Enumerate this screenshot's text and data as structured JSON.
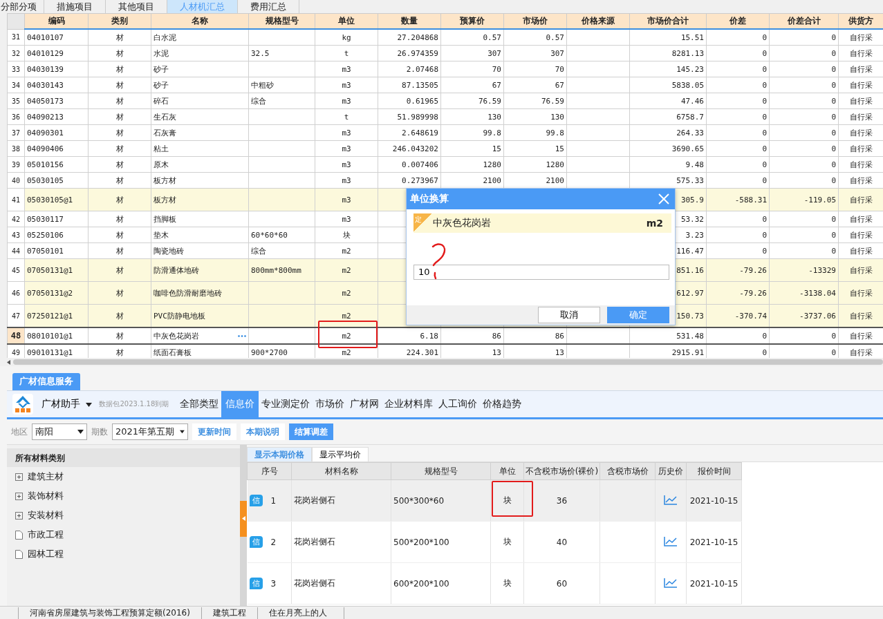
{
  "top_tabs": [
    {
      "label": "分部分项",
      "selected": false
    },
    {
      "label": "措施项目",
      "selected": false
    },
    {
      "label": "其他项目",
      "selected": false
    },
    {
      "label": "人材机汇总",
      "selected": true
    },
    {
      "label": "费用汇总",
      "selected": false
    }
  ],
  "table": {
    "columns": [
      "编码",
      "类别",
      "名称",
      "规格型号",
      "单位",
      "数量",
      "预算价",
      "市场价",
      "价格来源",
      "市场价合计",
      "价差",
      "价差合计",
      "供货方"
    ],
    "rows": [
      {
        "no": "31",
        "code": "04010107",
        "type": "材",
        "name": "白水泥",
        "unit": "kg",
        "qty": "27.204868",
        "budget": "0.57",
        "market": "0.57",
        "total": "15.51",
        "diff": "0",
        "diff_total": "0",
        "supply": "自行采",
        "modified": false,
        "selected": false
      },
      {
        "no": "32",
        "code": "04010129",
        "type": "材",
        "name": "水泥",
        "spec": "32.5",
        "unit": "t",
        "qty": "26.974359",
        "budget": "307",
        "market": "307",
        "total": "8281.13",
        "diff": "0",
        "diff_total": "0",
        "supply": "自行采",
        "modified": false,
        "selected": false
      },
      {
        "no": "33",
        "code": "04030139",
        "type": "材",
        "name": "砂子",
        "unit": "m3",
        "qty": "2.07468",
        "budget": "70",
        "market": "70",
        "total": "145.23",
        "diff": "0",
        "diff_total": "0",
        "supply": "自行采",
        "modified": false,
        "selected": false
      },
      {
        "no": "34",
        "code": "04030143",
        "type": "材",
        "name": "砂子",
        "spec": "中粗砂",
        "unit": "m3",
        "qty": "87.13505",
        "budget": "67",
        "market": "67",
        "total": "5838.05",
        "diff": "0",
        "diff_total": "0",
        "supply": "自行采",
        "modified": false,
        "selected": false
      },
      {
        "no": "35",
        "code": "04050173",
        "type": "材",
        "name": "碎石",
        "spec": "综合",
        "unit": "m3",
        "qty": "0.61965",
        "budget": "76.59",
        "market": "76.59",
        "total": "47.46",
        "diff": "0",
        "diff_total": "0",
        "supply": "自行采",
        "modified": false,
        "selected": false
      },
      {
        "no": "36",
        "code": "04090213",
        "type": "材",
        "name": "生石灰",
        "unit": "t",
        "qty": "51.989998",
        "budget": "130",
        "market": "130",
        "total": "6758.7",
        "diff": "0",
        "diff_total": "0",
        "supply": "自行采",
        "modified": false,
        "selected": false
      },
      {
        "no": "37",
        "code": "04090301",
        "type": "材",
        "name": "石灰膏",
        "unit": "m3",
        "qty": "2.648619",
        "budget": "99.8",
        "market": "99.8",
        "total": "264.33",
        "diff": "0",
        "diff_total": "0",
        "supply": "自行采",
        "modified": false,
        "selected": false
      },
      {
        "no": "38",
        "code": "04090406",
        "type": "材",
        "name": "粘土",
        "unit": "m3",
        "qty": "246.043202",
        "budget": "15",
        "market": "15",
        "total": "3690.65",
        "diff": "0",
        "diff_total": "0",
        "supply": "自行采",
        "modified": false,
        "selected": false
      },
      {
        "no": "39",
        "code": "05010156",
        "type": "材",
        "name": "原木",
        "unit": "m3",
        "qty": "0.007406",
        "budget": "1280",
        "market": "1280",
        "total": "9.48",
        "diff": "0",
        "diff_total": "0",
        "supply": "自行采",
        "modified": false,
        "selected": false
      },
      {
        "no": "40",
        "code": "05030105",
        "type": "材",
        "name": "板方材",
        "unit": "m3",
        "qty": "0.273967",
        "budget": "2100",
        "market": "2100",
        "total": "575.33",
        "diff": "0",
        "diff_total": "0",
        "supply": "自行采",
        "modified": false,
        "selected": false
      },
      {
        "no": "41",
        "code": "05030105@1",
        "type": "材",
        "name": "板方材",
        "unit": "m3",
        "total": "305.9",
        "diff": "-588.31",
        "diff_total": "-119.05",
        "supply": "自行采",
        "modified": true,
        "selected": false
      },
      {
        "no": "42",
        "code": "05030117",
        "type": "材",
        "name": "挡脚板",
        "unit": "m3",
        "total": "53.32",
        "diff": "0",
        "diff_total": "0",
        "supply": "自行采",
        "modified": false,
        "selected": false
      },
      {
        "no": "43",
        "code": "05250106",
        "type": "材",
        "name": "垫木",
        "spec": "60*60*60",
        "unit": "块",
        "total": "3.23",
        "diff": "0",
        "diff_total": "0",
        "supply": "自行采",
        "modified": false,
        "selected": false
      },
      {
        "no": "44",
        "code": "07050101",
        "type": "材",
        "name": "陶瓷地砖",
        "spec": "综合",
        "unit": "m2",
        "total": "116.47",
        "diff": "0",
        "diff_total": "0",
        "supply": "自行采",
        "modified": false,
        "selected": false
      },
      {
        "no": "45",
        "code": "07050131@1",
        "type": "材",
        "name": "防滑通体地砖",
        "spec": "800mm*800mm",
        "unit": "m2",
        "total": "851.16",
        "diff": "-79.26",
        "diff_total": "-13329",
        "supply": "自行采",
        "modified": true,
        "selected": false
      },
      {
        "no": "46",
        "code": "07050131@2",
        "type": "材",
        "name": "咖啡色防滑耐磨地砖",
        "unit": "m2",
        "total": "612.97",
        "diff": "-79.26",
        "diff_total": "-3138.04",
        "supply": "自行采",
        "modified": true,
        "selected": false
      },
      {
        "no": "47",
        "code": "07250121@1",
        "type": "材",
        "name": "PVC防静电地板",
        "unit": "m2",
        "total": "150.73",
        "diff": "-370.74",
        "diff_total": "-3737.06",
        "supply": "自行采",
        "modified": true,
        "selected": false
      },
      {
        "no": "48",
        "code": "08010101@1",
        "type": "材",
        "name": "中灰色花岗岩",
        "unit": "m2",
        "qty": "6.18",
        "budget": "86",
        "market": "86",
        "total": "531.48",
        "diff": "0",
        "diff_total": "0",
        "supply": "自行采",
        "modified": false,
        "selected": true
      },
      {
        "no": "49",
        "code": "09010131@1",
        "type": "材",
        "name": "纸面石膏板",
        "spec": "900*2700",
        "unit": "m2",
        "qty": "224.301",
        "budget": "13",
        "market": "13",
        "total": "2915.91",
        "diff": "0",
        "diff_total": "0",
        "supply": "自行采",
        "modified": false,
        "selected": false
      }
    ]
  },
  "dialog": {
    "title": "单位换算",
    "badge": "定",
    "material": "中灰色花岗岩",
    "unit": "m2",
    "value": "10",
    "buttons": [
      {
        "label": "取消",
        "primary": false
      },
      {
        "label": "确定",
        "primary": true
      }
    ]
  },
  "panel": {
    "tab": "广材信息服务",
    "brand": "广材助手",
    "expiry": "数据包2023.1.18到期",
    "nav": [
      {
        "label": "全部类型",
        "selected": false
      },
      {
        "label": "信息价",
        "selected": true
      },
      {
        "label": "专业测定价",
        "selected": false
      },
      {
        "label": "市场价",
        "selected": false
      },
      {
        "label": "广材网",
        "selected": false
      },
      {
        "label": "企业材料库",
        "selected": false
      },
      {
        "label": "人工询价",
        "selected": false
      },
      {
        "label": "价格趋势",
        "selected": false
      }
    ],
    "region_label": "地区",
    "region": "南阳",
    "period_label": "期数",
    "period": "2021年第五期",
    "actions": [
      {
        "label": "更新时间",
        "primary": false
      },
      {
        "label": "本期说明",
        "primary": false
      },
      {
        "label": "结算调差",
        "primary": true
      }
    ],
    "category_title": "所有材料类别",
    "categories": [
      {
        "label": "建筑主材",
        "kind": "group"
      },
      {
        "label": "装饰材料",
        "kind": "group"
      },
      {
        "label": "安装材料",
        "kind": "group"
      },
      {
        "label": "市政工程",
        "kind": "item"
      },
      {
        "label": "园林工程",
        "kind": "item"
      }
    ],
    "view_tabs": [
      {
        "label": "显示本期价格",
        "selected": true
      },
      {
        "label": "显示平均价",
        "selected": false
      }
    ],
    "columns": [
      "序号",
      "材料名称",
      "规格型号",
      "单位",
      "不含税市场价(裸价)",
      "含税市场价",
      "历史价",
      "报价时间"
    ],
    "rows": [
      {
        "badge": "信",
        "seq": "1",
        "name": "花岗岩侧石",
        "spec": "500*300*60",
        "unit": "块",
        "price": "36",
        "date": "2021-10-15",
        "selected": true
      },
      {
        "badge": "信",
        "seq": "2",
        "name": "花岗岩侧石",
        "spec": "500*200*100",
        "unit": "块",
        "price": "40",
        "date": "2021-10-15",
        "selected": false
      },
      {
        "badge": "信",
        "seq": "3",
        "name": "花岗岩侧石",
        "spec": "600*200*100",
        "unit": "块",
        "price": "60",
        "date": "2021-10-15",
        "selected": false
      }
    ]
  },
  "status_bar": [
    "河南省房屋建筑与装饰工程预算定额(2016)",
    "建筑工程",
    "住在月亮上的人"
  ]
}
